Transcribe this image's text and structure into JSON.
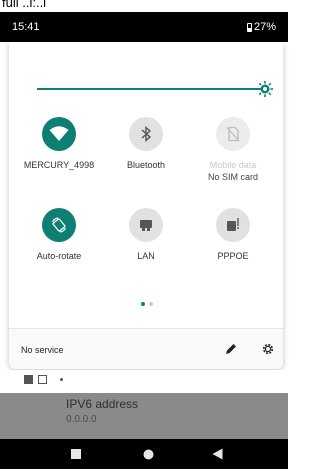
{
  "top_fragment": "fuil ..i:..i",
  "statusbar": {
    "time": "15:41",
    "battery": "27%"
  },
  "tiles": [
    {
      "label": "MERCURY_4998",
      "sub": "",
      "state": "on",
      "icon": "wifi-icon"
    },
    {
      "label": "Bluetooth",
      "sub": "",
      "state": "off",
      "icon": "bluetooth-icon"
    },
    {
      "label": "Mobile data",
      "sub": "No SIM card",
      "state": "disabled",
      "icon": "no-sim-icon"
    },
    {
      "label": "Auto-rotate",
      "sub": "",
      "state": "on",
      "icon": "auto-rotate-icon"
    },
    {
      "label": "LAN",
      "sub": "",
      "state": "off",
      "icon": "lan-icon"
    },
    {
      "label": "PPPOE",
      "sub": "",
      "state": "off",
      "icon": "pppoe-icon"
    }
  ],
  "page_indicator": {
    "pages": 2,
    "current": 1
  },
  "footer": {
    "service": "No service"
  },
  "behind": {
    "title": "IPV6 address",
    "value": "0.0.0.0"
  },
  "colors": {
    "accent": "#0e7f73",
    "tile_off": "#e1e1e1",
    "statusbar": "#000000"
  }
}
